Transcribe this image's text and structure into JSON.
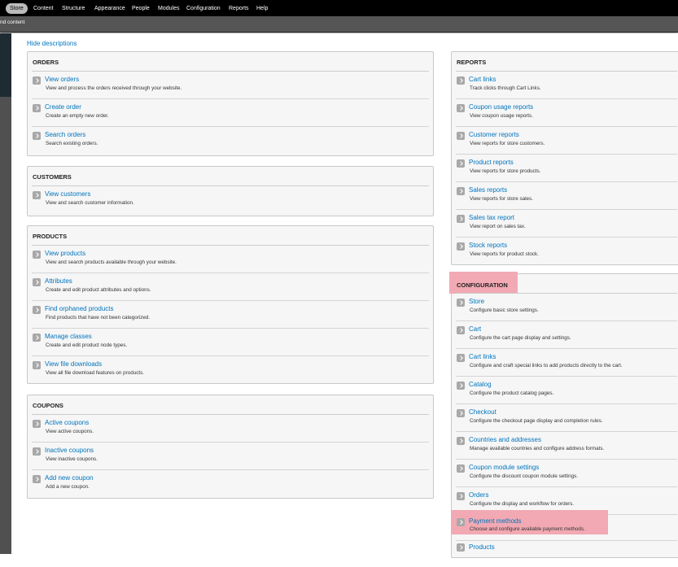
{
  "toolbar": {
    "items": [
      "Store",
      "Content",
      "Structure",
      "Appearance",
      "People",
      "Modules",
      "Configuration",
      "Reports",
      "Help"
    ]
  },
  "shortcuts": {
    "label": "nd content"
  },
  "hide_descriptions": "Hide descriptions",
  "panels": {
    "orders": {
      "title": "ORDERS",
      "items": [
        {
          "label": "View orders",
          "desc": "View and process the orders received through your website."
        },
        {
          "label": "Create order",
          "desc": "Create an empty new order."
        },
        {
          "label": "Search orders",
          "desc": "Search existing orders."
        }
      ]
    },
    "customers": {
      "title": "CUSTOMERS",
      "items": [
        {
          "label": "View customers",
          "desc": "View and search customer information."
        }
      ]
    },
    "products": {
      "title": "PRODUCTS",
      "items": [
        {
          "label": "View products",
          "desc": "View and search products available through your website."
        },
        {
          "label": "Attributes",
          "desc": "Create and edit product attributes and options."
        },
        {
          "label": "Find orphaned products",
          "desc": "Find products that have not been categorized."
        },
        {
          "label": "Manage classes",
          "desc": "Create and edit product node types."
        },
        {
          "label": "View file downloads",
          "desc": "View all file download features on products."
        }
      ]
    },
    "coupons": {
      "title": "COUPONS",
      "items": [
        {
          "label": "Active coupons",
          "desc": "View active coupons."
        },
        {
          "label": "Inactive coupons",
          "desc": "View inactive coupons."
        },
        {
          "label": "Add new coupon",
          "desc": "Add a new coupon."
        }
      ]
    },
    "reports": {
      "title": "REPORTS",
      "items": [
        {
          "label": "Cart links",
          "desc": "Track clicks through Cart Links."
        },
        {
          "label": "Coupon usage reports",
          "desc": "View coupon usage reports."
        },
        {
          "label": "Customer reports",
          "desc": "View reports for store customers."
        },
        {
          "label": "Product reports",
          "desc": "View reports for store products."
        },
        {
          "label": "Sales reports",
          "desc": "View reports for store sales."
        },
        {
          "label": "Sales tax report",
          "desc": "View report on sales tax."
        },
        {
          "label": "Stock reports",
          "desc": "View reports for product stock."
        }
      ]
    },
    "configuration": {
      "title": "CONFIGURATION",
      "highlight_color": "#f2a9b3",
      "items": [
        {
          "label": "Store",
          "desc": "Configure basic store settings."
        },
        {
          "label": "Cart",
          "desc": "Configure the cart page display and settings."
        },
        {
          "label": "Cart links",
          "desc": "Configure and craft special links to add products directly to the cart."
        },
        {
          "label": "Catalog",
          "desc": "Configure the product catalog pages."
        },
        {
          "label": "Checkout",
          "desc": "Configure the checkout page display and completion rules."
        },
        {
          "label": "Countries and addresses",
          "desc": "Manage available countries and configure address formats."
        },
        {
          "label": "Coupon module settings",
          "desc": "Configure the discount coupon module settings."
        },
        {
          "label": "Orders",
          "desc": "Configure the display and workflow for orders."
        },
        {
          "label": "Payment methods",
          "desc": "Choose and configure available payment methods."
        },
        {
          "label": "Products",
          "desc": ""
        }
      ]
    }
  }
}
